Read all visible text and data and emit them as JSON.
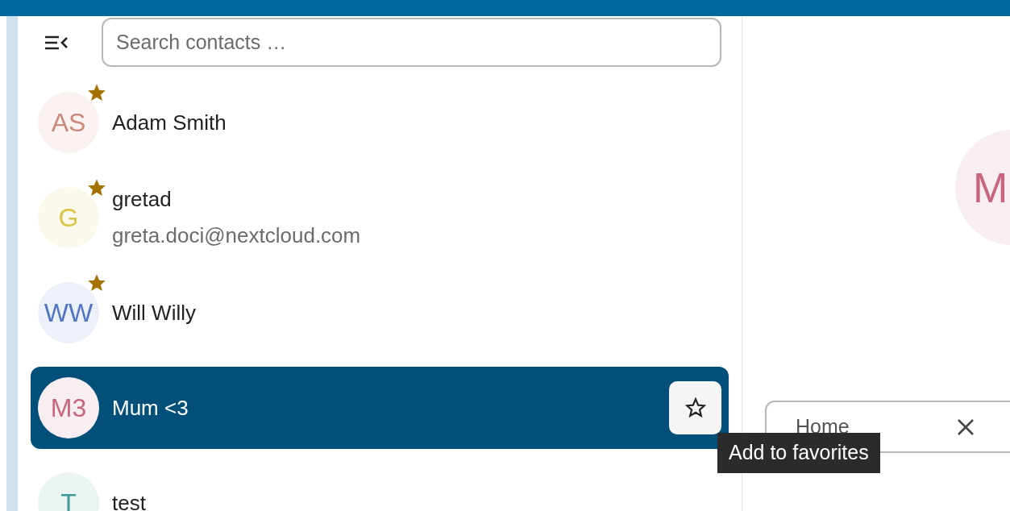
{
  "search": {
    "placeholder": "Search contacts …"
  },
  "contacts": [
    {
      "initials": "AS",
      "name": "Adam Smith",
      "color": "#c98879",
      "favorite": true,
      "selected": false
    },
    {
      "initials": "G",
      "name": "gretad",
      "email": "greta.doci@nextcloud.com",
      "color": "#d9c445",
      "favorite": true,
      "selected": false
    },
    {
      "initials": "WW",
      "name": "Will Willy",
      "color": "#4f74c4",
      "favorite": true,
      "selected": false
    },
    {
      "initials": "M3",
      "name": "Mum <3",
      "color": "#c7657d",
      "favorite": false,
      "selected": true
    },
    {
      "initials": "T",
      "name": "test",
      "color": "#3f9a96",
      "favorite": false,
      "selected": false
    }
  ],
  "tooltip": "Add to favorites",
  "detail": {
    "avatar_initials": "M",
    "field_value": "Home"
  }
}
